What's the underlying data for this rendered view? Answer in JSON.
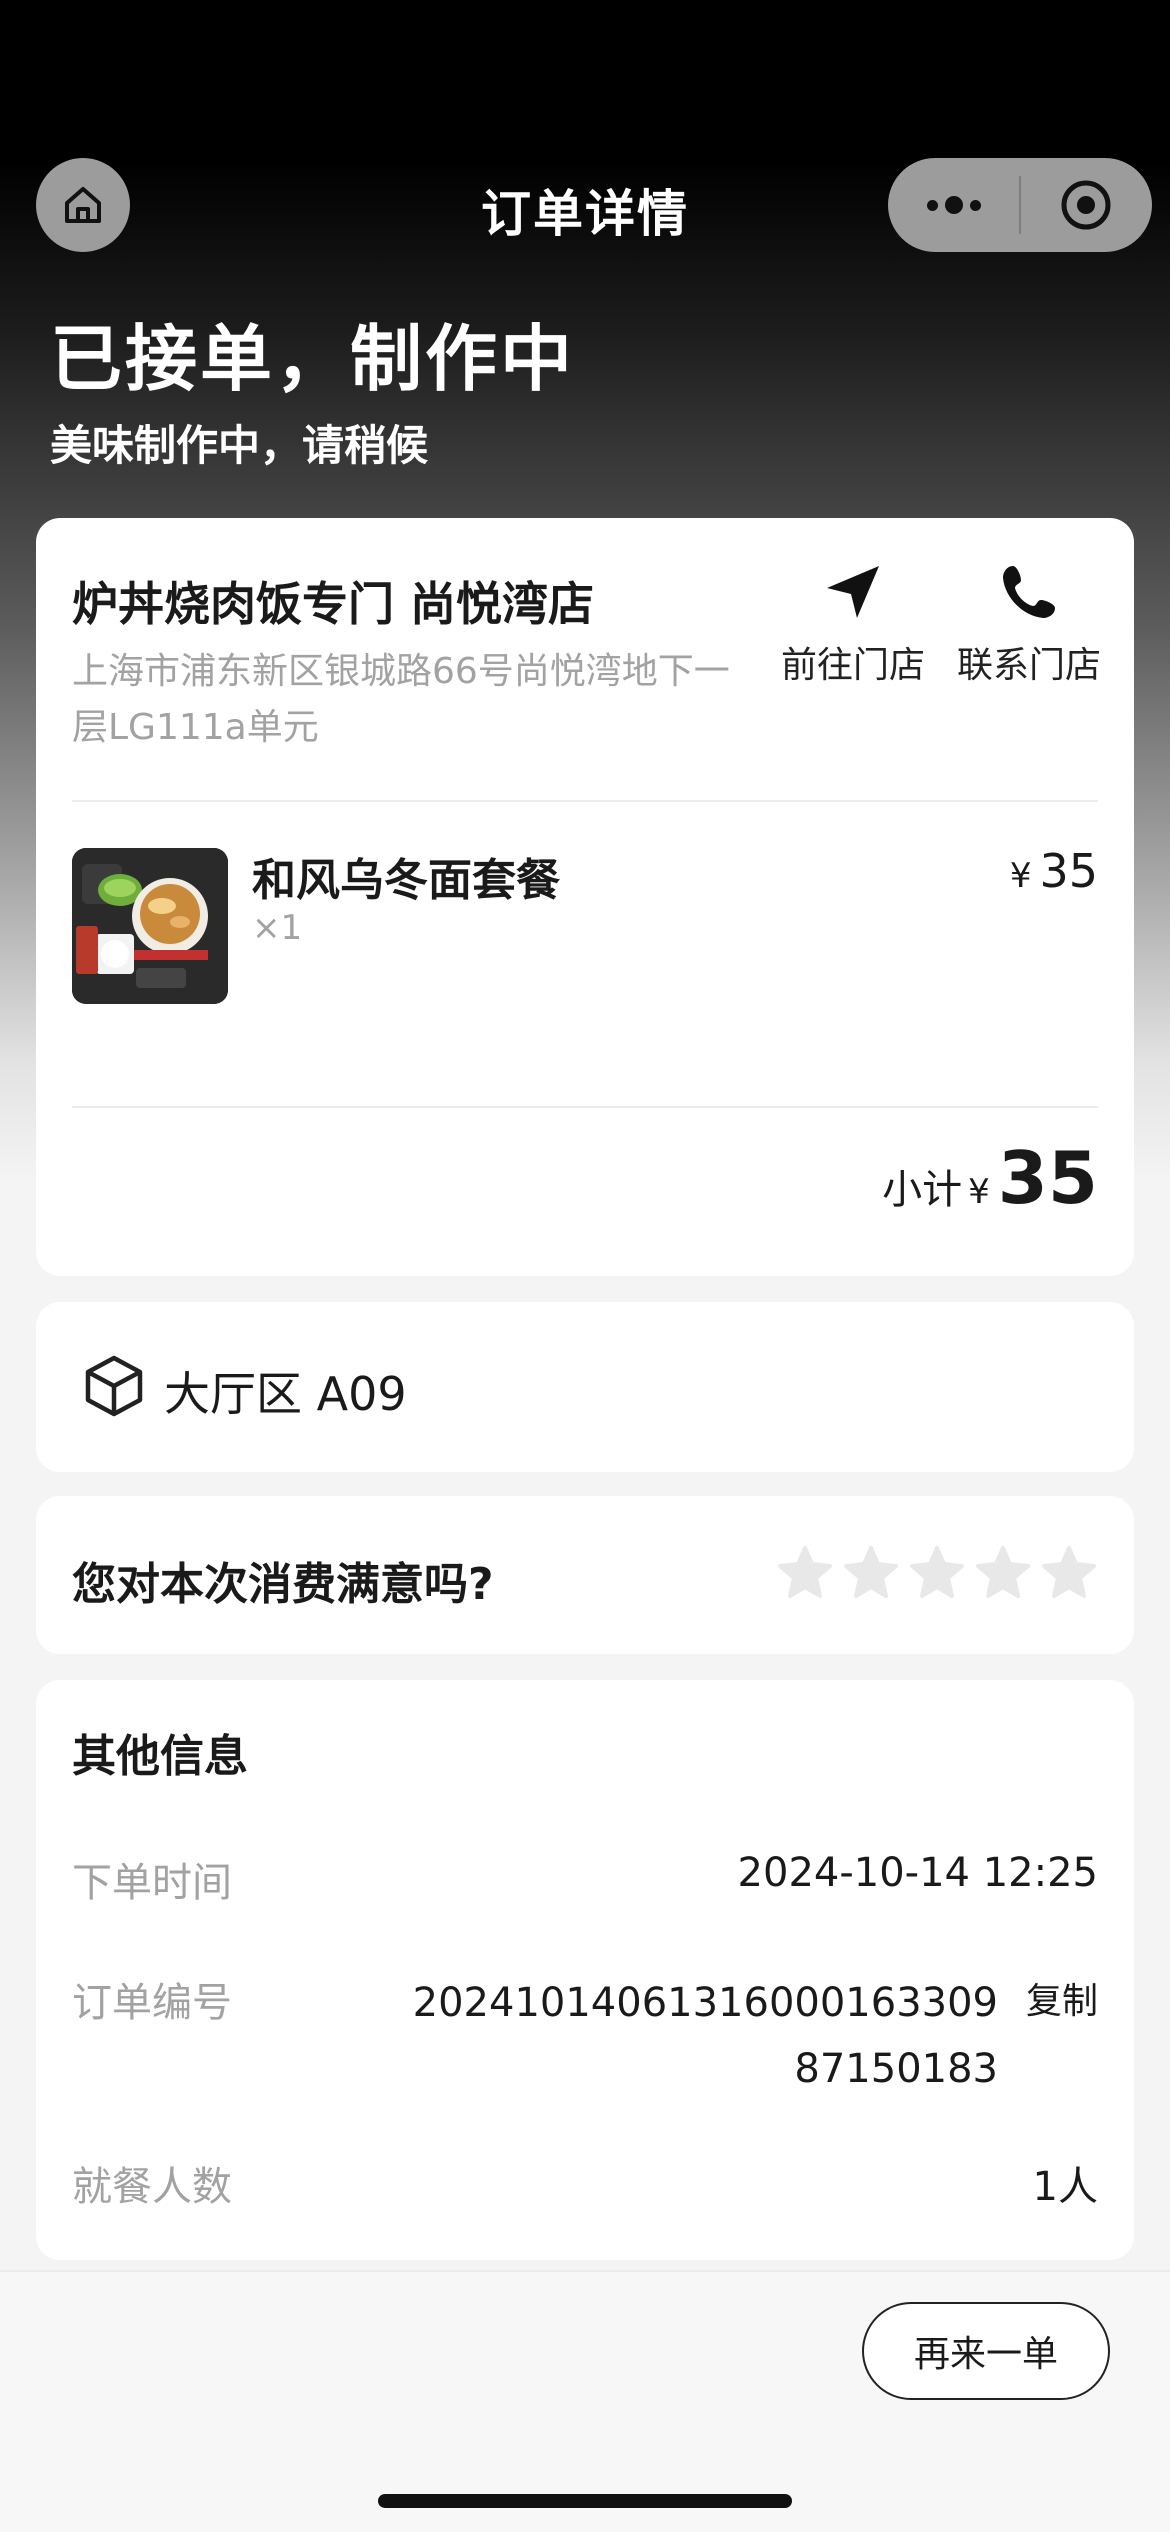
{
  "header": {
    "title": "订单详情"
  },
  "status": {
    "title": "已接单，制作中",
    "subtitle": "美味制作中，请稍候"
  },
  "store": {
    "name": "炉丼烧肉饭专门 尚悦湾店",
    "address": "上海市浦东新区银城路66号尚悦湾地下一层LG111a单元",
    "navigate_label": "前往门店",
    "contact_label": "联系门店"
  },
  "items": [
    {
      "name": "和风乌冬面套餐",
      "qty": "×1",
      "currency": "¥",
      "price": "35"
    }
  ],
  "subtotal": {
    "label": "小计",
    "currency": "¥",
    "amount": "35"
  },
  "table": {
    "text": "大厅区 A09"
  },
  "rating": {
    "question": "您对本次消费满意吗?",
    "stars_total": 5,
    "stars_selected": 0
  },
  "other_info": {
    "title": "其他信息",
    "order_time_label": "下单时间",
    "order_time_value": "2024-10-14 12:25",
    "order_no_label": "订单编号",
    "order_no_value": "2024101406131600016330987150183",
    "copy_label": "复制",
    "diners_label": "就餐人数",
    "diners_value": "1人"
  },
  "footer": {
    "reorder_label": "再来一单"
  },
  "colors": {
    "accent": "#000000",
    "muted_text": "#a2a2a2",
    "star_inactive": "#e8e8e8"
  }
}
